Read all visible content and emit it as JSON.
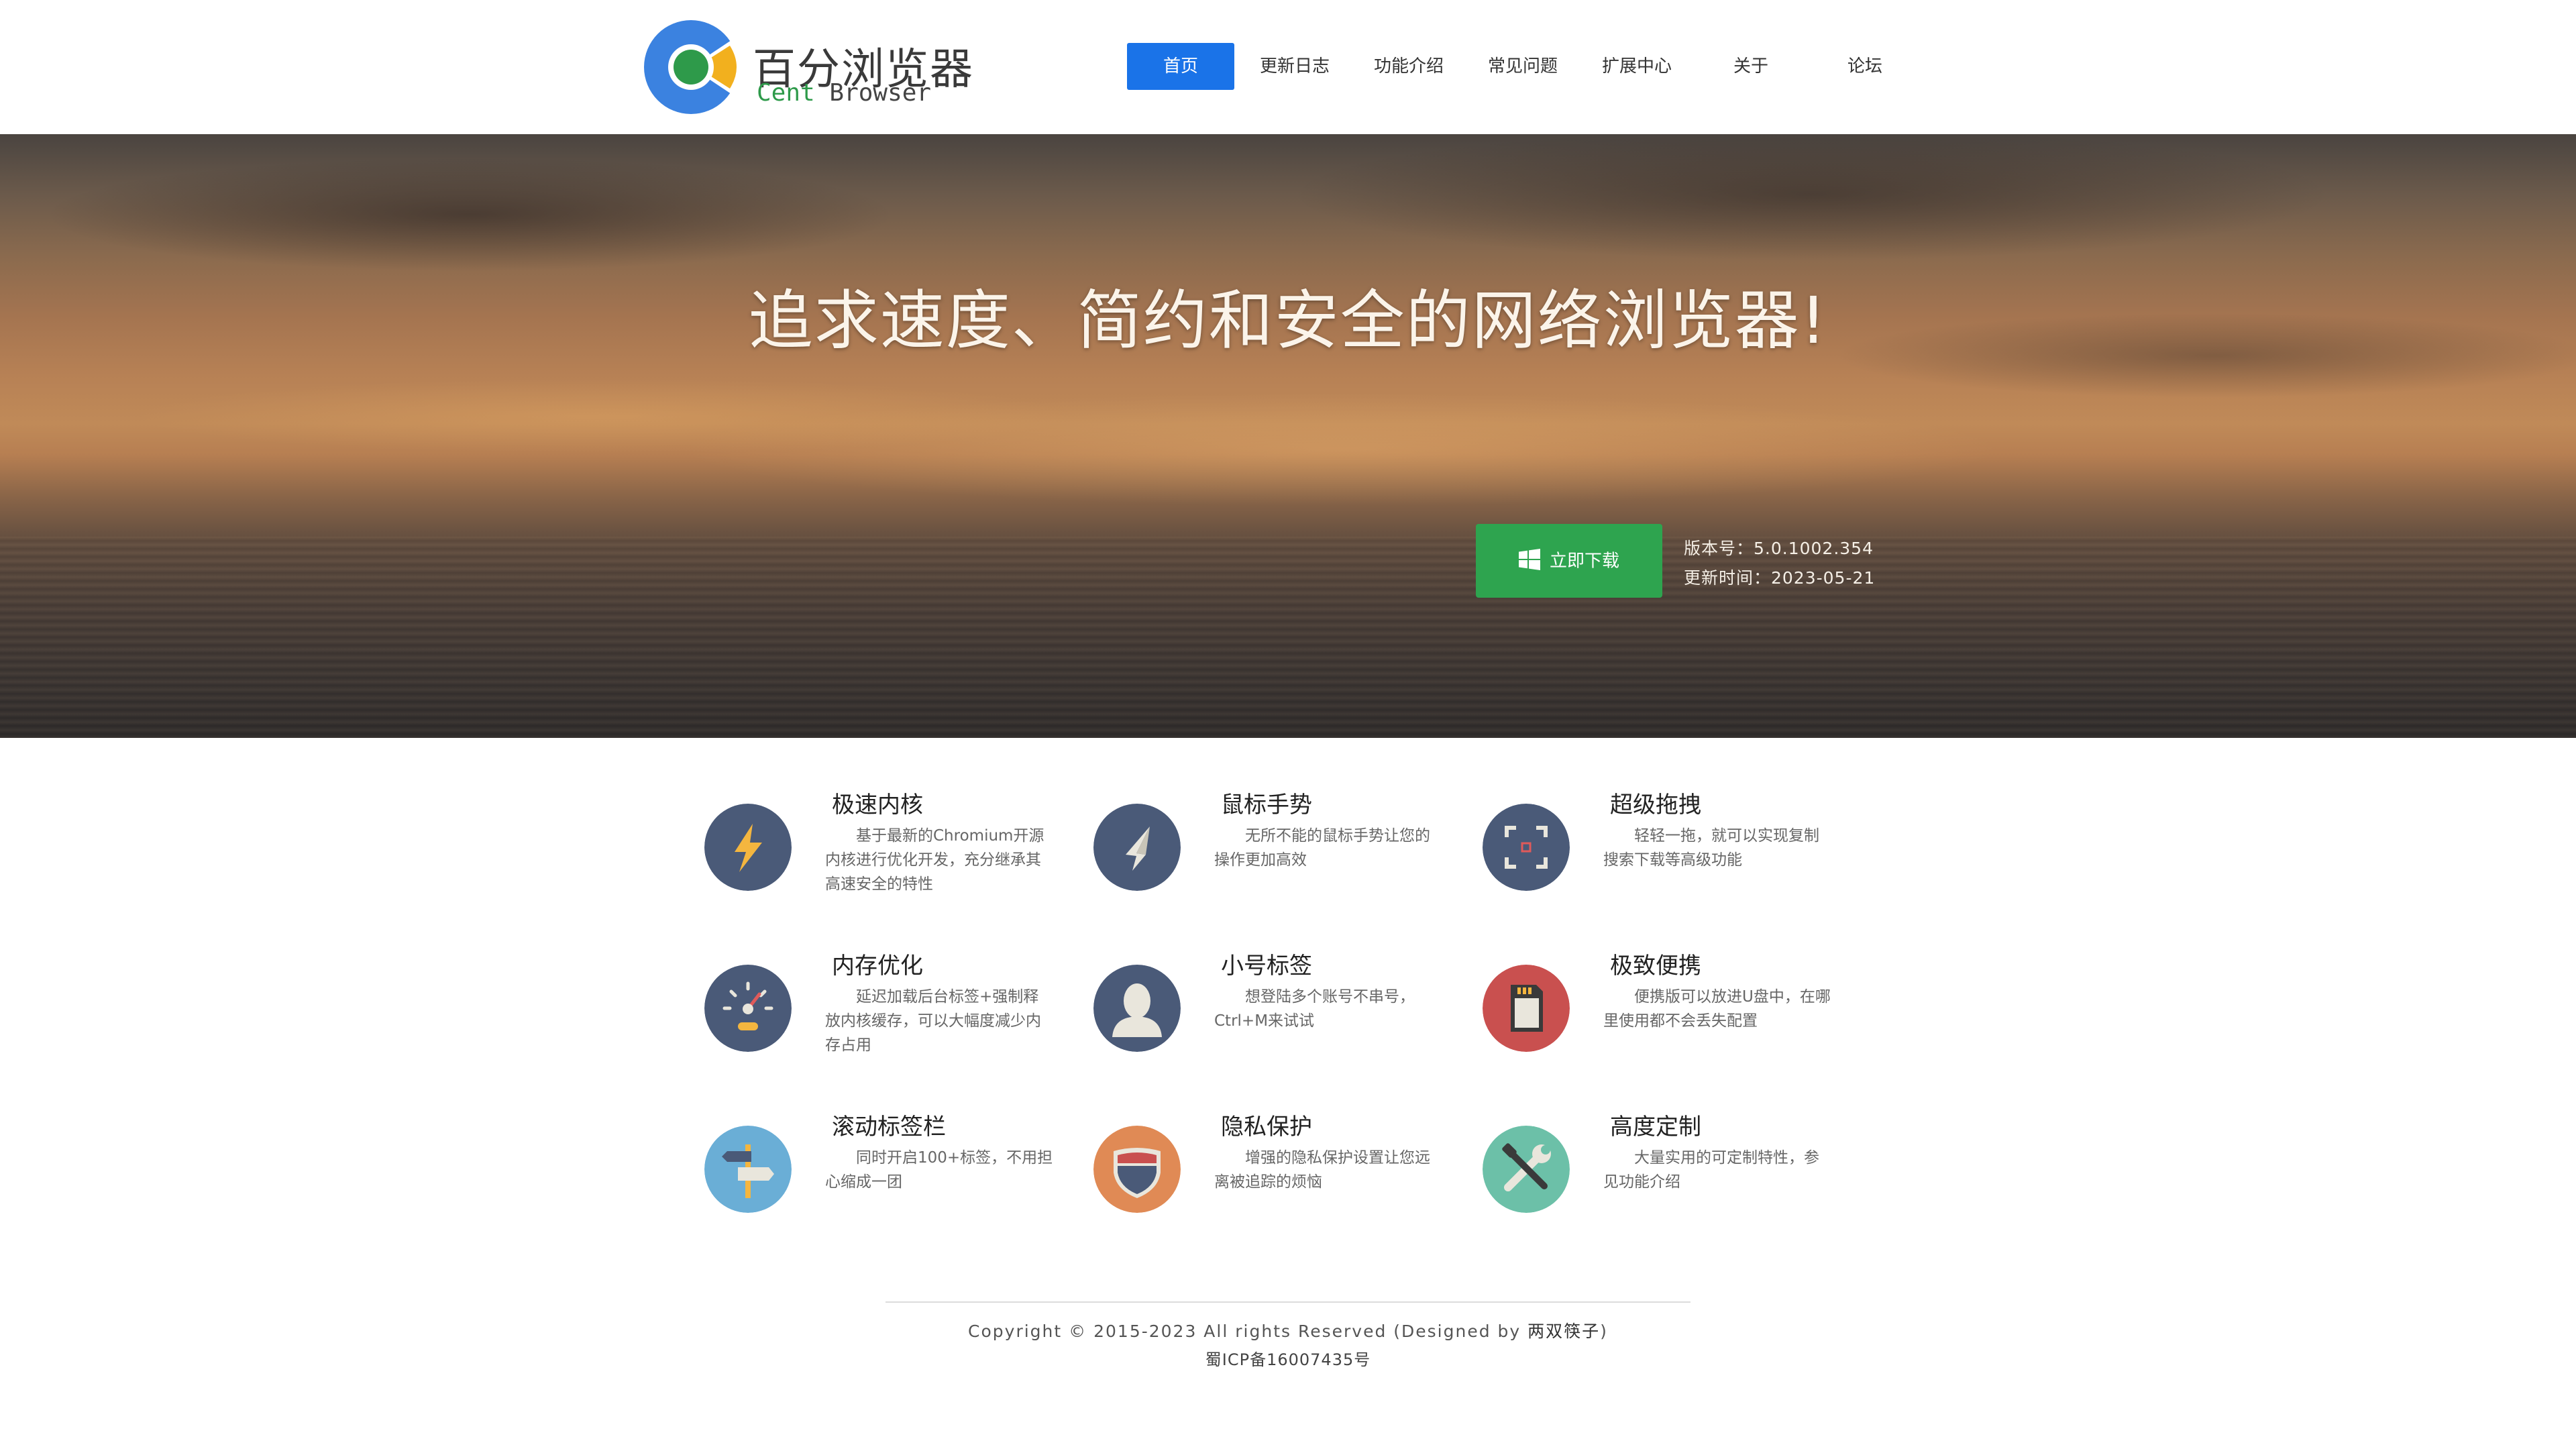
{
  "header": {
    "logo": {
      "cn": "百分浏览器",
      "en_cent": "Cent",
      "en_browser": "Browser"
    },
    "nav": [
      {
        "label": "首页",
        "active": true
      },
      {
        "label": "更新日志"
      },
      {
        "label": "功能介绍"
      },
      {
        "label": "常见问题"
      },
      {
        "label": "扩展中心"
      },
      {
        "label": "关于"
      },
      {
        "label": "论坛"
      }
    ]
  },
  "hero": {
    "title": "追求速度、简约和安全的网络浏览器!",
    "download_label": "立即下载",
    "download_icon": "windows-icon",
    "version": "版本号：5.0.1002.354",
    "updated": "更新时间：2023-05-21"
  },
  "features": [
    {
      "title": "极速内核",
      "desc": "基于最新的Chromium开源内核进行优化开发，充分继承其高速安全的特性",
      "icon": "lightning-icon",
      "color": "#4a5a78"
    },
    {
      "title": "鼠标手势",
      "desc": "无所不能的鼠标手势让您的操作更加高效",
      "icon": "cursor-icon",
      "color": "#4a5a78"
    },
    {
      "title": "超级拖拽",
      "desc": "轻轻一拖，就可以实现复制搜索下载等高级功能",
      "icon": "drag-target-icon",
      "color": "#4a5a78"
    },
    {
      "title": "内存优化",
      "desc": "延迟加载后台标签+强制释放内核缓存，可以大幅度减少内存占用",
      "icon": "gauge-icon",
      "color": "#4a5a78"
    },
    {
      "title": "小号标签",
      "desc": "想登陆多个账号不串号，Ctrl+M来试试",
      "icon": "user-icon",
      "color": "#4a5a78"
    },
    {
      "title": "极致便携",
      "desc": "便携版可以放进U盘中，在哪里使用都不会丢失配置",
      "icon": "sd-card-icon",
      "color": "#c9504f"
    },
    {
      "title": "滚动标签栏",
      "desc": "同时开启100+标签，不用担心缩成一团",
      "icon": "signpost-icon",
      "color": "#6aaed6"
    },
    {
      "title": "隐私保护",
      "desc": "增强的隐私保护设置让您远离被追踪的烦恼",
      "icon": "shield-icon",
      "color": "#e08a55"
    },
    {
      "title": "高度定制",
      "desc": "大量实用的可定制特性，参见功能介绍",
      "icon": "tools-icon",
      "color": "#6cc0a8"
    }
  ],
  "footer": {
    "copyright_prefix": "Copyright © 2015-2023 All rights Reserved (Designed by ",
    "designer": "两双筷子",
    "copyright_suffix": ")",
    "icp": "蜀ICP备16007435号"
  }
}
